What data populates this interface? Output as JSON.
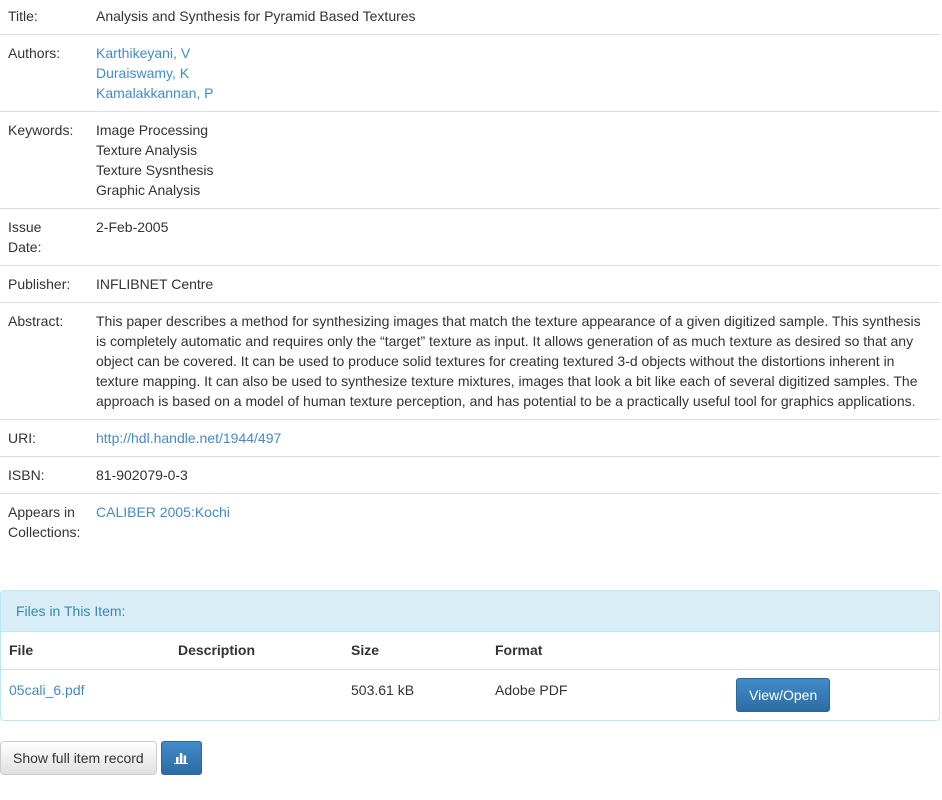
{
  "metadata": {
    "title_label": "Title:",
    "title_value": "Analysis and Synthesis for Pyramid Based Textures",
    "authors_label": "Authors:",
    "authors": [
      "Karthikeyani, V",
      "Duraiswamy, K",
      "Kamalakkannan, P"
    ],
    "keywords_label": "Keywords:",
    "keywords": [
      "Image Processing",
      "Texture Analysis",
      "Texture Sysnthesis",
      "Graphic Analysis"
    ],
    "issue_date_label_1": "Issue",
    "issue_date_label_2": "Date:",
    "issue_date_value": "2-Feb-2005",
    "publisher_label": "Publisher:",
    "publisher_value": "INFLIBNET Centre",
    "abstract_label": "Abstract:",
    "abstract_lines": [
      "This paper describes a method for synthesizing images that match the texture appearance of a given digitized sample. This synthesis",
      "is completely automatic and requires only the “target” texture as input. It allows generation of as much texture as desired so that any",
      "object can be covered. It can be used to produce solid textures for creating textured 3-d objects without the distortions inherent in",
      "texture mapping. It can also be used to synthesize texture mixtures, images that look a bit like each of several digitized samples. The",
      "approach is based on a model of human texture perception, and has potential to be a practically useful tool for graphics applications."
    ],
    "uri_label": "URI:",
    "uri_value": "http://hdl.handle.net/1944/497",
    "isbn_label": "ISBN:",
    "isbn_value": "81-902079-0-3",
    "collections_label_1": "Appears in",
    "collections_label_2": "Collections:",
    "collections_value": "CALIBER 2005:Kochi"
  },
  "files": {
    "heading": "Files in This Item:",
    "columns": [
      "File",
      "Description",
      "Size",
      "Format"
    ],
    "rows": [
      {
        "file": "05cali_6.pdf",
        "description": "",
        "size": "503.61 kB",
        "format": "Adobe PDF",
        "action": "View/Open"
      }
    ]
  },
  "buttons": {
    "full_record": "Show full item record",
    "stats_icon": "bar-chart-icon"
  },
  "colors": {
    "link": "#428bca",
    "primary": "#3276b1",
    "panel_heading_bg": "#d9edf7",
    "panel_heading_text": "#3a87ad"
  }
}
